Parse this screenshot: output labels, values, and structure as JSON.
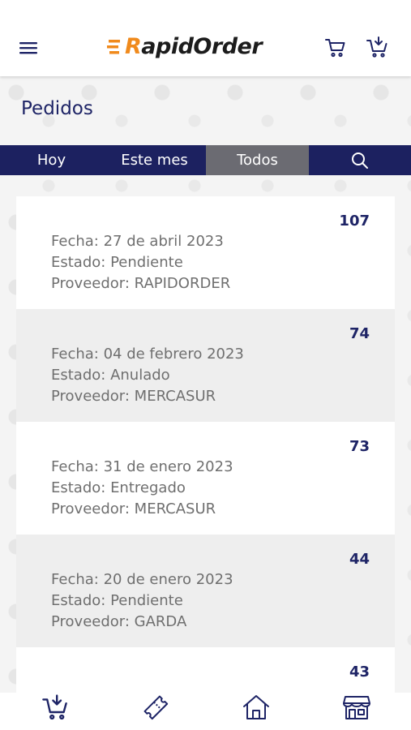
{
  "header": {
    "logo_first": "R",
    "logo_rest": "apidOrder",
    "brand_color": "#f08a1c",
    "icons": [
      "menu-icon",
      "cart-icon",
      "cart-add-icon"
    ]
  },
  "page": {
    "title": "Pedidos"
  },
  "tabs": [
    {
      "label": "Hoy"
    },
    {
      "label": "Este mes"
    },
    {
      "label": "Todos",
      "active": true
    }
  ],
  "orders": [
    {
      "number": "107",
      "fecha": "Fecha: 27 de abril 2023",
      "estado": "Estado: Pendiente",
      "proveedor": "Proveedor: RAPIDORDER"
    },
    {
      "number": "74",
      "fecha": "Fecha: 04 de febrero 2023",
      "estado": "Estado: Anulado",
      "proveedor": "Proveedor: MERCASUR"
    },
    {
      "number": "73",
      "fecha": "Fecha: 31 de enero 2023",
      "estado": "Estado: Entregado",
      "proveedor": "Proveedor: MERCASUR"
    },
    {
      "number": "44",
      "fecha": "Fecha: 20 de enero 2023",
      "estado": "Estado: Pendiente",
      "proveedor": "Proveedor: GARDA"
    },
    {
      "number": "43"
    }
  ],
  "bottom_nav": [
    "cart-add-icon",
    "ticket-icon",
    "home-icon",
    "store-icon"
  ],
  "colors": {
    "navy": "#1c2160",
    "active_tab": "#6b6b72",
    "text_gray": "#6f6f6f"
  }
}
